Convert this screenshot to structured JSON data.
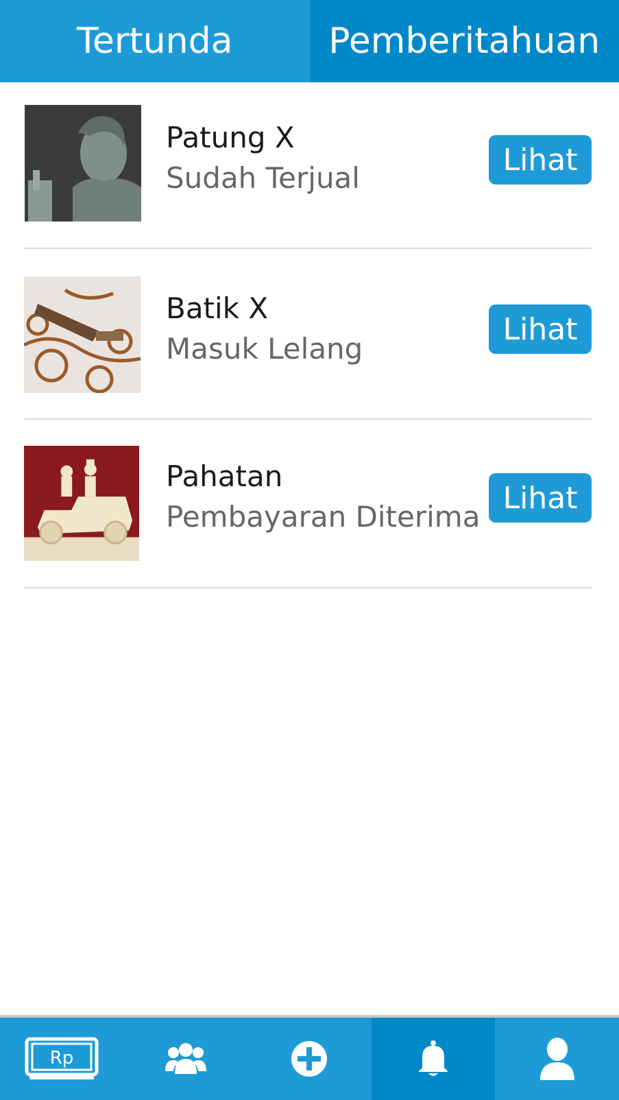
{
  "tabs": {
    "pending_label": "Tertunda",
    "notifications_label": "Pemberitahuan",
    "active": "notifications"
  },
  "items": [
    {
      "title": "Patung X",
      "status": "Sudah Terjual",
      "button": "Lihat",
      "thumbnail": "statue-photo"
    },
    {
      "title": "Batik X",
      "status": "Masuk Lelang",
      "button": "Lihat",
      "thumbnail": "batik-photo"
    },
    {
      "title": "Pahatan",
      "status": "Pembayaran Diterima",
      "button": "Lihat",
      "thumbnail": "carving-photo"
    }
  ],
  "bottom_nav": {
    "items": [
      {
        "icon": "money-monitor-icon",
        "label_text": "Rp"
      },
      {
        "icon": "group-icon"
      },
      {
        "icon": "add-circle-icon"
      },
      {
        "icon": "bell-icon",
        "active": true
      },
      {
        "icon": "user-icon"
      }
    ]
  },
  "colors": {
    "primary": "#1e9bd7",
    "primary_dark": "#0088c9",
    "divider": "#d9d9d9"
  }
}
